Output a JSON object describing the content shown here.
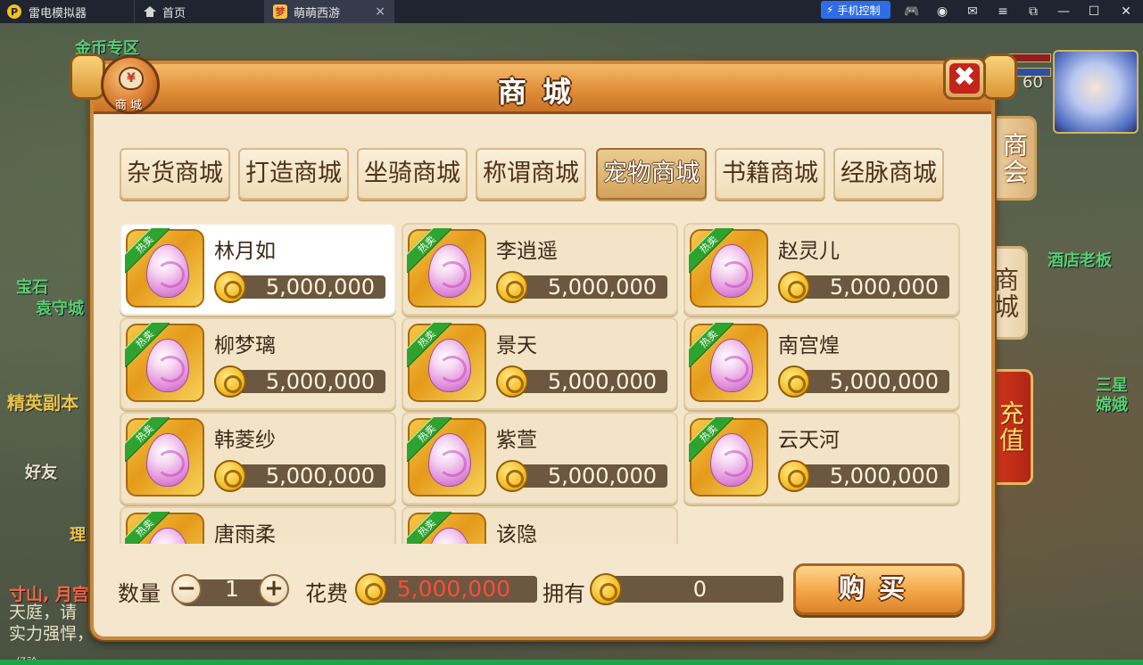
{
  "emulator": {
    "app_name": "雷电模拟器",
    "tabs": [
      {
        "label": "首页"
      },
      {
        "label": "萌萌西游"
      }
    ],
    "phone_control_label": "手机控制",
    "tab_close_glyph": "×"
  },
  "scene": {
    "map_labels": [
      "金币专区",
      "宝石",
      "袁守城",
      "精英副本",
      "好友",
      "酒店老板",
      "三星",
      "嫦娥",
      "寸山, 月宫",
      "理"
    ],
    "chat_lines": [
      "天庭，请",
      "实力强悍，"
    ],
    "level_text": "60",
    "bottom_text": "经验"
  },
  "shop": {
    "title": "商城",
    "badge_label": "商城",
    "badge_symbol": "¥",
    "close_glyph": "✖",
    "side_tabs": [
      "商会",
      "商城",
      "充值"
    ],
    "categories": [
      {
        "label": "杂货商城",
        "active": false
      },
      {
        "label": "打造商城",
        "active": false
      },
      {
        "label": "坐骑商城",
        "active": false
      },
      {
        "label": "称谓商城",
        "active": false
      },
      {
        "label": "宠物商城",
        "active": true
      },
      {
        "label": "书籍商城",
        "active": false
      },
      {
        "label": "经脉商城",
        "active": false
      }
    ],
    "hot_label": "热卖",
    "items": [
      {
        "name": "林月如",
        "price": "5,000,000",
        "selected": true
      },
      {
        "name": "李逍遥",
        "price": "5,000,000",
        "selected": false
      },
      {
        "name": "赵灵儿",
        "price": "5,000,000",
        "selected": false
      },
      {
        "name": "柳梦璃",
        "price": "5,000,000",
        "selected": false
      },
      {
        "name": "景天",
        "price": "5,000,000",
        "selected": false
      },
      {
        "name": "南宫煌",
        "price": "5,000,000",
        "selected": false
      },
      {
        "name": "韩菱纱",
        "price": "5,000,000",
        "selected": false
      },
      {
        "name": "紫萱",
        "price": "5,000,000",
        "selected": false
      },
      {
        "name": "云天河",
        "price": "5,000,000",
        "selected": false
      },
      {
        "name": "唐雨柔",
        "price": "",
        "selected": false
      },
      {
        "name": "该隐",
        "price": "",
        "selected": false
      }
    ],
    "bottom": {
      "quantity_label": "数量",
      "quantity_value": "1",
      "minus_glyph": "−",
      "plus_glyph": "+",
      "cost_label": "花费",
      "cost_value": "5,000,000",
      "owned_label": "拥有",
      "owned_value": "0",
      "buy_label": "购买"
    }
  },
  "colors": {
    "header_orange": "#e08e38",
    "panel_cream": "#f4e7ce",
    "price_bar": "#6c5740",
    "hot_ribbon": "#2fa32f",
    "cost_red": "#ff4b3c",
    "recharge_red": "#c52f18"
  }
}
